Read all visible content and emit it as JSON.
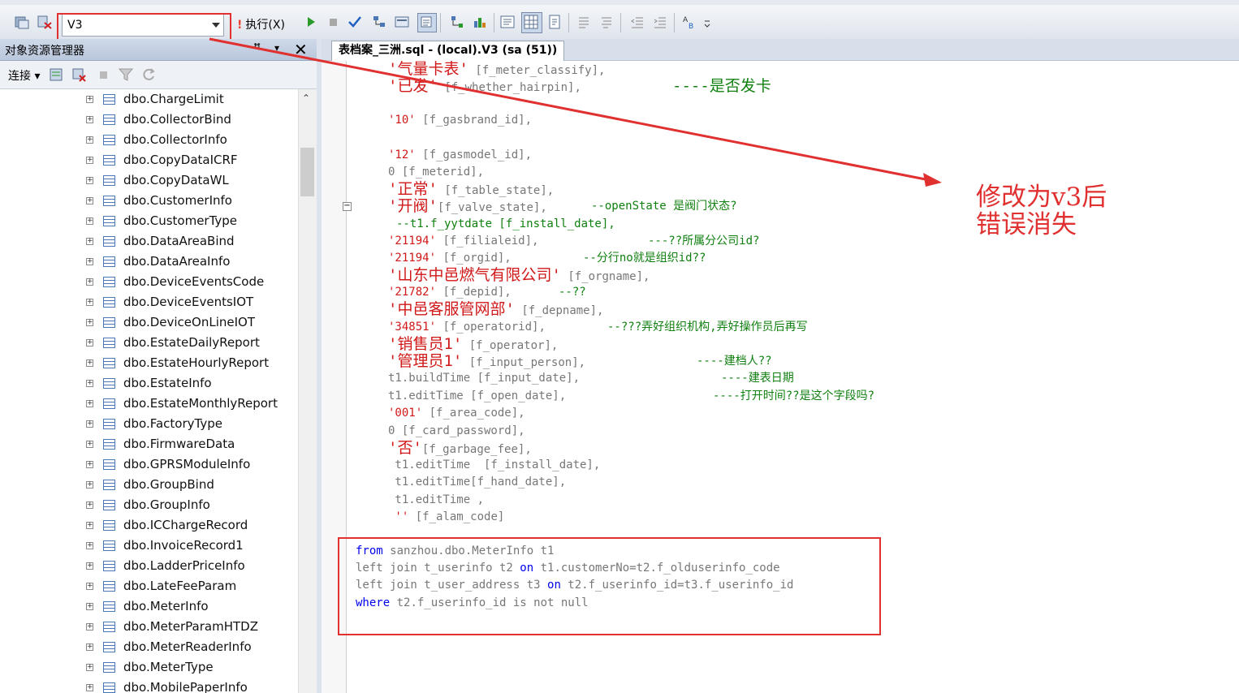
{
  "toolbar": {
    "database": "V3",
    "execute_label": "执行(X)"
  },
  "object_explorer": {
    "title": "对象资源管理器",
    "connect_label": "连接",
    "items": [
      "dbo.ChargeLimit",
      "dbo.CollectorBind",
      "dbo.CollectorInfo",
      "dbo.CopyDataICRF",
      "dbo.CopyDataWL",
      "dbo.CustomerInfo",
      "dbo.CustomerType",
      "dbo.DataAreaBind",
      "dbo.DataAreaInfo",
      "dbo.DeviceEventsCode",
      "dbo.DeviceEventsIOT",
      "dbo.DeviceOnLineIOT",
      "dbo.EstateDailyReport",
      "dbo.EstateHourlyReport",
      "dbo.EstateInfo",
      "dbo.EstateMonthlyReport",
      "dbo.FactoryType",
      "dbo.FirmwareData",
      "dbo.GPRSModuleInfo",
      "dbo.GroupBind",
      "dbo.GroupInfo",
      "dbo.ICChargeRecord",
      "dbo.InvoiceRecord1",
      "dbo.LadderPriceInfo",
      "dbo.LateFeeParam",
      "dbo.MeterInfo",
      "dbo.MeterParamHTDZ",
      "dbo.MeterReaderInfo",
      "dbo.MeterType",
      "dbo.MobilePaperInfo"
    ]
  },
  "editor": {
    "tab_title": "表档案_三洲.sql - (local).V3 (sa (51))",
    "code": {
      "l1_str": "'气量卡表'",
      "l1_rest": " [f_meter_classify],",
      "l2_str": "'已发'",
      "l2_rest": " [f_whether_hairpin],",
      "l2_cm": "----是否发卡",
      "l3_str": "'10'",
      "l3_rest": " [f_gasbrand_id],",
      "l4_str": "'12'",
      "l4_rest": " [f_gasmodel_id],",
      "l5": "0 [f_meterid],",
      "l6_str": "'正常'",
      "l6_rest": " [f_table_state],",
      "l7_str": "'开阀'",
      "l7_rest": "[f_valve_state],",
      "l7_cm": "--openState 是阀门状态?",
      "l8_cm": "--t1.f_yytdate [f_install_date],",
      "l9_str": "'21194'",
      "l9_rest": " [f_filialeid],",
      "l9_cm": "---??所属分公司id?",
      "l10_str": "'21194'",
      "l10_rest": " [f_orgid],",
      "l10_cm": "--分行no就是组织id??",
      "l11_str": "'山东中邑燃气有限公司'",
      "l11_rest": " [f_orgname],",
      "l12_str": "'21782'",
      "l12_rest": " [f_depid],",
      "l12_cm": "--??",
      "l13_str": "'中邑客服管网部'",
      "l13_rest": " [f_depname],",
      "l14_str": "'34851'",
      "l14_rest": " [f_operatorid],",
      "l14_cm": "--???弄好组织机构,弄好操作员后再写",
      "l15_str": "'销售员1'",
      "l15_rest": " [f_operator],",
      "l16_str": "'管理员1'",
      "l16_rest": " [f_input_person],",
      "l16_cm": "----建档人??",
      "l17": "t1.buildTime [f_input_date],",
      "l17_cm": "----建表日期",
      "l18": "t1.editTime [f_open_date],",
      "l18_cm": "----打开时间??是这个字段吗?",
      "l19_str": "'001'",
      "l19_rest": " [f_area_code],",
      "l20": "0 [f_card_password],",
      "l21_str": "'否'",
      "l21_rest": "[f_garbage_fee],",
      "l22": " t1.editTime  [f_install_date],",
      "l23": " t1.editTime[f_hand_date],",
      "l24": " t1.editTime ,",
      "l25_str": " ''",
      "l25_rest": " [f_alam_code]",
      "from_kw": "from",
      "from_rest": " sanzhou.dbo.MeterInfo t1",
      "lj1_kw": "left join",
      "lj1_a": " t_userinfo t2 ",
      "lj1_on": "on",
      "lj1_b": " t1.customerNo=t2.f_olduserinfo_code",
      "lj2_kw": "left join",
      "lj2_a": " t_user_address t3 ",
      "lj2_on": "on",
      "lj2_b": " t2.f_userinfo_id=t3.f_userinfo_id",
      "where_kw": "where",
      "where_a": " t2.f_userinfo_id ",
      "where_b": "is not null"
    }
  },
  "annotation": {
    "line1": "修改为v3后",
    "line2": "错误消失"
  },
  "colors": {
    "string": "#d01818",
    "comment": "#108010",
    "keyword": "#0000ee",
    "annotation": "#e03030"
  }
}
